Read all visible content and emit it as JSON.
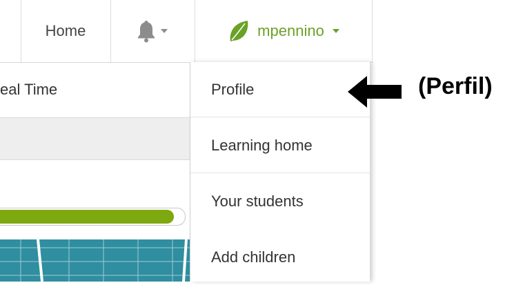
{
  "nav": {
    "home_label": "Home",
    "bell_icon": "bell-icon",
    "user_icon": "leaf-icon",
    "username": "mpennino"
  },
  "background": {
    "realtime_label": "eal Time",
    "progress": 0.94
  },
  "dropdown": {
    "items": [
      {
        "label": "Profile"
      },
      {
        "label": "Learning home"
      },
      {
        "label": "Your students"
      },
      {
        "label": "Add children"
      }
    ]
  },
  "annotation": {
    "text": "(Perfil)"
  },
  "colors": {
    "accent_green": "#6aa228",
    "progress_green": "#7ea80f",
    "icon_grey": "#8c8c8c",
    "chart_teal": "#2f8ea0"
  }
}
